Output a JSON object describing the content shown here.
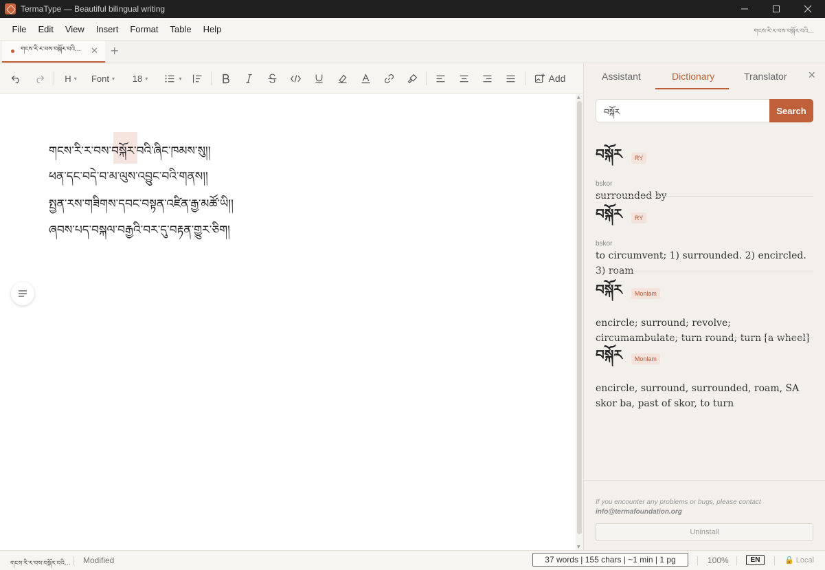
{
  "window": {
    "title": "TermaType — Beautiful bilingual writing",
    "controls": {
      "minimize": "—",
      "maximize": "☐",
      "close": "✕"
    }
  },
  "menubar": {
    "items": [
      "File",
      "Edit",
      "View",
      "Insert",
      "Format",
      "Table",
      "Help"
    ],
    "doc_name": "གངས་རི་ར་བས་བསྐོར་བའི..."
  },
  "tabs": {
    "active_label": "གངས་རི་ར་བས་བསྐོར་བའི...",
    "close": "✕",
    "new": "+"
  },
  "toolbar": {
    "heading": "H",
    "font": "Font",
    "font_size": "18",
    "add": "Add"
  },
  "editor": {
    "lines": [
      "གངས་རི་ར་བས་བསྐོར་བའི་ཞིང་ཁམས་སུ།།",
      "ཕན་དང་བདེ་བ་མ་ལུས་འབྱུང་བའི་གནས།།",
      "སྤྱན་རས་གཟིགས་དབང་བསྟན་འཛིན་རྒྱ་མཚོ་ཡི།།",
      "ཞབས་པད་བསྐལ་བརྒྱའི་བར་དུ་བརྟན་གྱུར་ཅིག།"
    ]
  },
  "panel": {
    "tabs": [
      "Assistant",
      "Dictionary",
      "Translator"
    ],
    "active_tab": "Dictionary",
    "close": "✕",
    "search": {
      "value": "བསྐོར",
      "button": "Search"
    },
    "entries": [
      {
        "term": "བསྐོར",
        "source": "RY",
        "translit": "bskor",
        "definition": "surrounded by"
      },
      {
        "term": "བསྐོར",
        "source": "RY",
        "translit": "bskor",
        "definition": "to circumvent; 1) surrounded. 2) encircled. 3) roam"
      },
      {
        "term": "བསྐོར",
        "source": "Monlam",
        "translit": "",
        "definition": "encircle; surround; revolve; circumambulate; turn round; turn [a wheel]"
      },
      {
        "term": "བསྐོར",
        "source": "Monlam",
        "translit": "",
        "definition": "encircle, surround, surrounded, roam, SA skor ba, past of skor, to turn"
      }
    ],
    "footer_note": "If you encounter any problems or bugs, please contact",
    "footer_email": "info@termafoundation.org",
    "uninstall": "Uninstall"
  },
  "status": {
    "doc_name": "གངས་རི་ར་བས་བསྐོར་བའི...",
    "state": "Modified",
    "stats": "37 words | 155 chars | ~1 min | 1 pg",
    "zoom": "100%",
    "lang": "EN",
    "storage": "Local"
  },
  "colors": {
    "accent": "#c0603a",
    "titlebar": "#202020",
    "panel_bg": "#f3f0eb",
    "highlight": "#f6e4de"
  }
}
